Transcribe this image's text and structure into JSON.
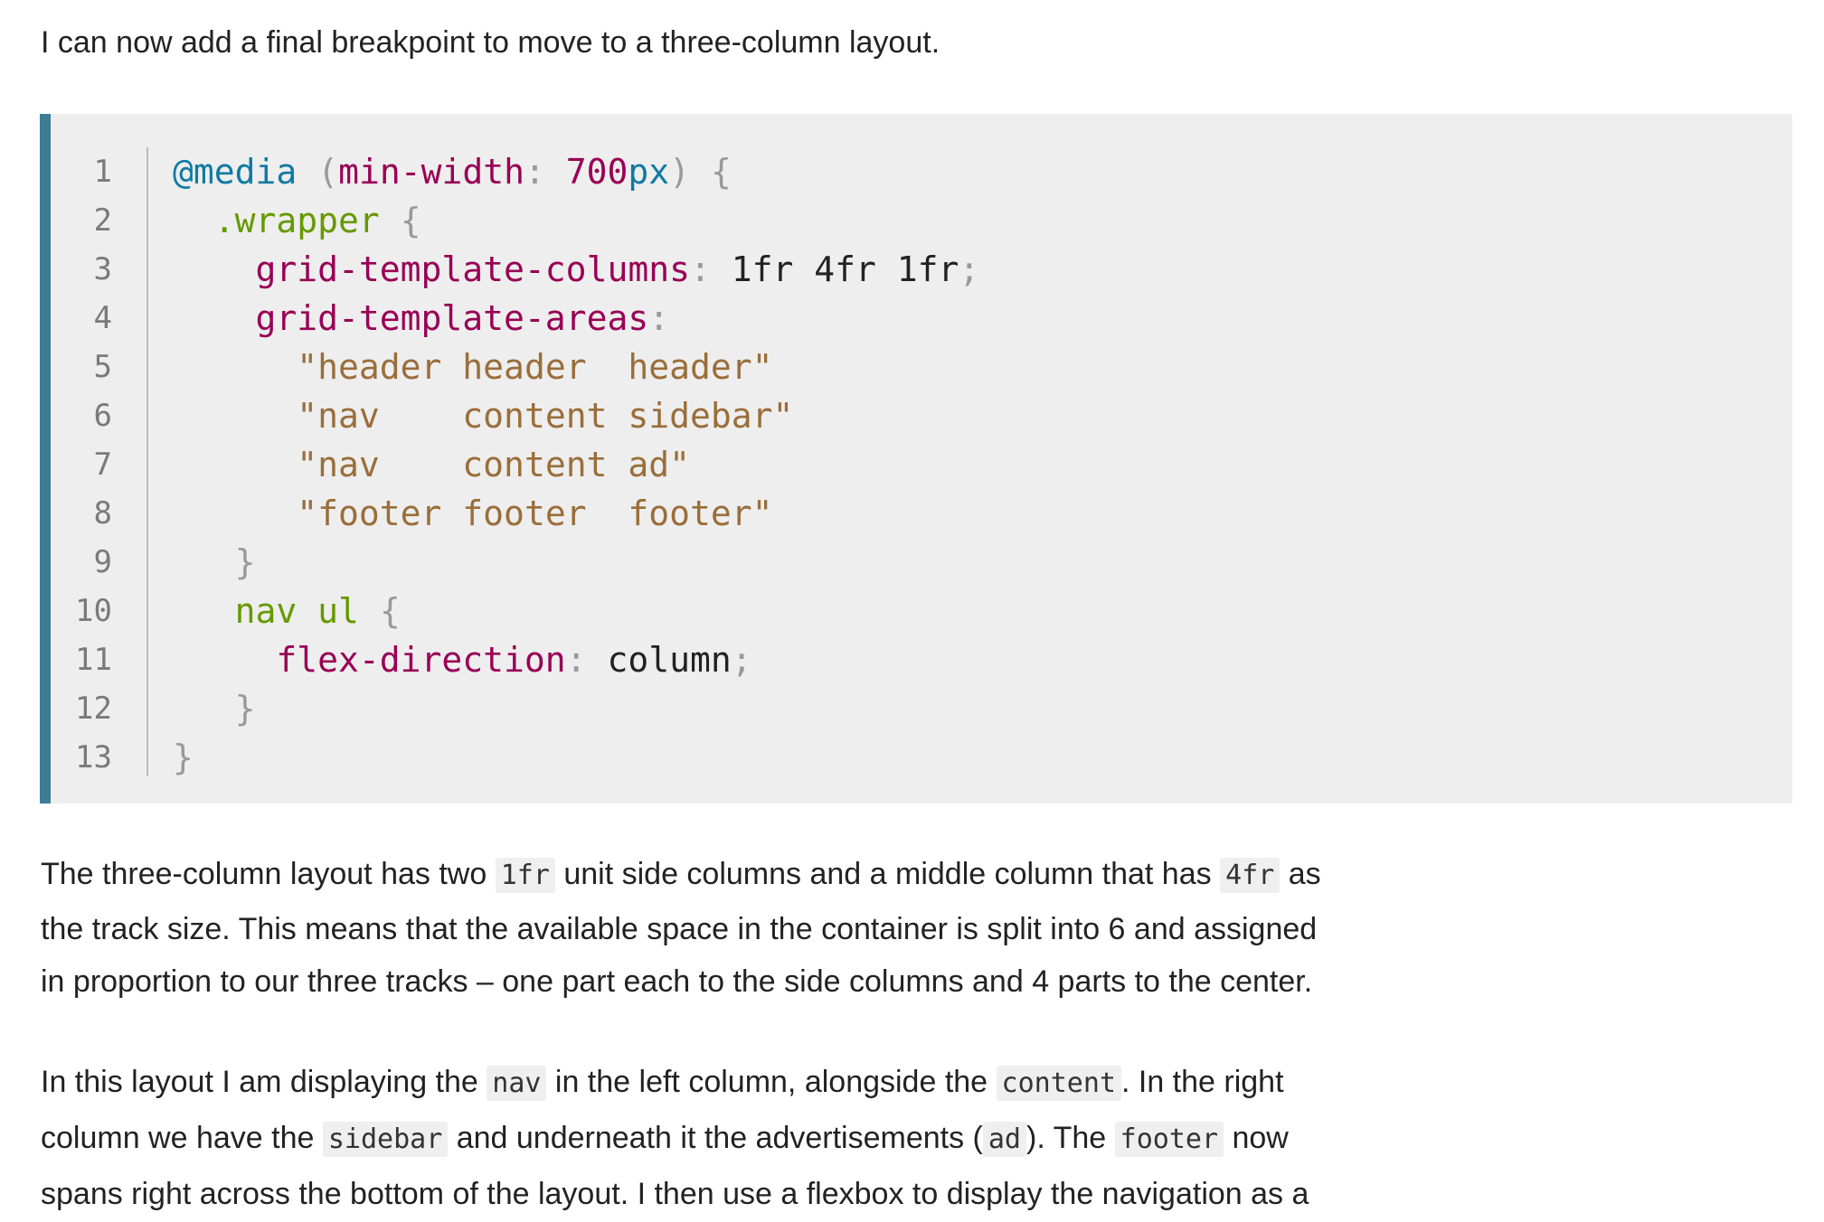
{
  "intro": "I can now add a final breakpoint to move to a three-column layout.",
  "code": {
    "line_numbers": [
      "1",
      "2",
      "3",
      "4",
      "5",
      "6",
      "7",
      "8",
      "9",
      "10",
      "11",
      "12",
      "13"
    ],
    "lines": [
      [
        {
          "t": "@media",
          "c": "at"
        },
        {
          "t": " ",
          "c": "val"
        },
        {
          "t": "(",
          "c": "punc"
        },
        {
          "t": "min-width",
          "c": "prop"
        },
        {
          "t": ":",
          "c": "punc"
        },
        {
          "t": " ",
          "c": "val"
        },
        {
          "t": "700",
          "c": "num"
        },
        {
          "t": "px",
          "c": "unit"
        },
        {
          "t": ")",
          "c": "punc"
        },
        {
          "t": " ",
          "c": "val"
        },
        {
          "t": "{",
          "c": "punc"
        }
      ],
      [
        {
          "t": "  ",
          "c": "val"
        },
        {
          "t": ".wrapper",
          "c": "sel"
        },
        {
          "t": " ",
          "c": "val"
        },
        {
          "t": "{",
          "c": "punc"
        }
      ],
      [
        {
          "t": "    ",
          "c": "val"
        },
        {
          "t": "grid-template-columns",
          "c": "prop"
        },
        {
          "t": ":",
          "c": "punc"
        },
        {
          "t": " 1fr 4fr 1fr",
          "c": "val"
        },
        {
          "t": ";",
          "c": "punc"
        }
      ],
      [
        {
          "t": "    ",
          "c": "val"
        },
        {
          "t": "grid-template-areas",
          "c": "prop"
        },
        {
          "t": ":",
          "c": "punc"
        }
      ],
      [
        {
          "t": "      ",
          "c": "val"
        },
        {
          "t": "\"header header  header\"",
          "c": "str"
        }
      ],
      [
        {
          "t": "      ",
          "c": "val"
        },
        {
          "t": "\"nav    content sidebar\"",
          "c": "str"
        }
      ],
      [
        {
          "t": "      ",
          "c": "val"
        },
        {
          "t": "\"nav    content ad\"",
          "c": "str"
        }
      ],
      [
        {
          "t": "      ",
          "c": "val"
        },
        {
          "t": "\"footer footer  footer\"",
          "c": "str"
        }
      ],
      [
        {
          "t": "   ",
          "c": "val"
        },
        {
          "t": "}",
          "c": "punc"
        }
      ],
      [
        {
          "t": "   ",
          "c": "val"
        },
        {
          "t": "nav ul",
          "c": "sel"
        },
        {
          "t": " ",
          "c": "val"
        },
        {
          "t": "{",
          "c": "punc"
        }
      ],
      [
        {
          "t": "     ",
          "c": "val"
        },
        {
          "t": "flex-direction",
          "c": "prop"
        },
        {
          "t": ":",
          "c": "punc"
        },
        {
          "t": " column",
          "c": "val"
        },
        {
          "t": ";",
          "c": "punc"
        }
      ],
      [
        {
          "t": "   ",
          "c": "val"
        },
        {
          "t": "}",
          "c": "punc"
        }
      ],
      [
        {
          "t": "}",
          "c": "punc"
        }
      ]
    ]
  },
  "para1": {
    "l1_a": "The three-column layout has two ",
    "l1_code1": "1fr",
    "l1_b": " unit side columns and a middle column that has ",
    "l1_code2": "4fr",
    "l1_c": " as",
    "l2": "the track size. This means that the available space in the container is split into 6 and assigned",
    "l3": "in proportion to our three tracks – one part each to the side columns and 4 parts to the center."
  },
  "para2": {
    "l1_a": "In this layout I am displaying the ",
    "l1_code1": "nav",
    "l1_b": " in the left column, alongside the ",
    "l1_code2": "content",
    "l1_c": ". In the right",
    "l2_a": "column we have the ",
    "l2_code1": "sidebar",
    "l2_b": " and underneath it the advertisements (",
    "l2_code2": "ad",
    "l2_c": "). The ",
    "l2_code3": "footer",
    "l2_d": " now",
    "l3": "spans right across the bottom of the layout. I then use a flexbox to display the navigation as a"
  }
}
